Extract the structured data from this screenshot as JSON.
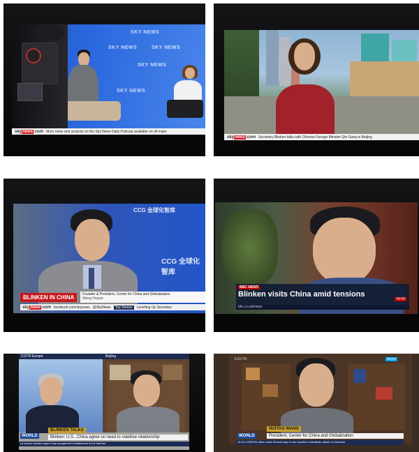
{
  "panel1": {
    "wall_words": [
      "SKY NEWS",
      "SKY NEWS",
      "SKY NEWS",
      "SKY NEWS",
      "SKY NEWS"
    ],
    "sky_logo": {
      "brand": "sky",
      "news": "news",
      "suffix": ".com"
    },
    "ticker": "More news and analysis on the Sky News Daily Podcast available on all major"
  },
  "panel2": {
    "sky_logo": {
      "brand": "sky",
      "news": "news",
      "suffix": ".com"
    },
    "ticker": "Secretary Blinken talks with Chinese Foreign Minister Qin Gang in Beijing"
  },
  "panel3": {
    "ccg_text": [
      "CCG 全球化智库",
      "CCG 全球化智库"
    ],
    "strap_headline": "BLINKEN IN CHINA",
    "strap_title": "Founder & President, Center for China and Globalization",
    "strap_name": "Wang Huiyao",
    "sky_logo": {
      "brand": "sky",
      "news": "news",
      "suffix": ".com"
    },
    "footer_links": [
      "facebook.com/skynews",
      "@SkyNews"
    ],
    "footer_badge": "Top Stories",
    "footer_ticker": "Levelling Up Secretary"
  },
  "panel4": {
    "bbc_logo": "BBC NEWS",
    "headline": "Blinken visits China amid tensions",
    "footer": "bbc.co.uk/news",
    "time": "09:09"
  },
  "panel5": {
    "header_left": "CGTN Europe",
    "header_right": "Beijing",
    "strap_name": "BLINKEN TALKS",
    "strap_text": "Blinken: U.S., China agree on need to stabilise relationship",
    "world_logo": "WORLD",
    "bar_text": "ue issues    Ukraine says it has recaptured 8 settlements in the last two"
  },
  "panel6": {
    "cgtn_logo": "CGTN",
    "skype_logo": "skype",
    "strap_name": "HUIYAO WANG",
    "strap_text": "President, Center for China and Globalization",
    "world_logo": "WORLD",
    "bar_text": "15:16  LONDON   athen areas    Russia says it has repelled a Ukrainian attack on Novodar"
  }
}
